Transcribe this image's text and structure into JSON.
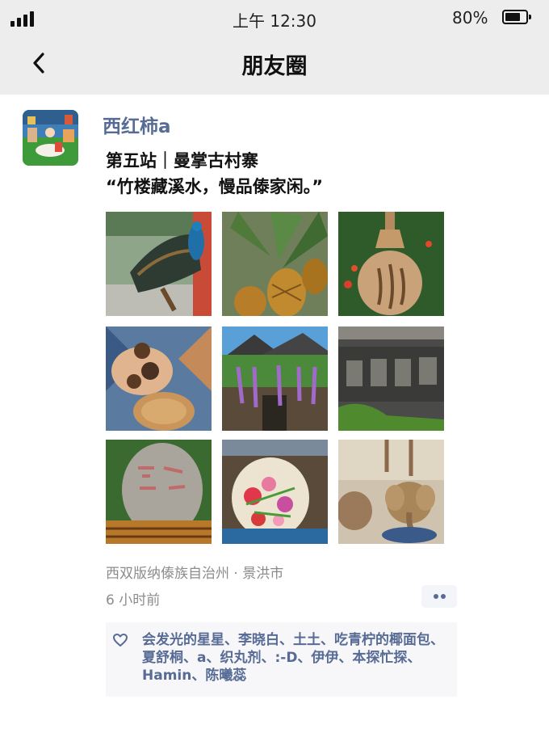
{
  "status_bar": {
    "time": "上午 12:30",
    "battery_percent": "80%",
    "battery_level": 0.8
  },
  "nav": {
    "title": "朋友圈",
    "back_icon": "chevron-left-icon"
  },
  "post": {
    "author": "西红柿a",
    "text_line1": "第五站｜曼掌古村寨",
    "text_line2": "“竹楼藏溪水，慢品傣家闲。”",
    "photos": [
      {
        "name": "peacock-photo"
      },
      {
        "name": "pineapple-photo"
      },
      {
        "name": "clay-lantern-photo"
      },
      {
        "name": "seed-pods-photo"
      },
      {
        "name": "wisteria-house-photo"
      },
      {
        "name": "wooden-sign-photo"
      },
      {
        "name": "carved-stone-photo"
      },
      {
        "name": "flower-fan-photo"
      },
      {
        "name": "clay-elephant-photo"
      }
    ],
    "location": "西双版纳傣族自治州 · 景洪市",
    "time_ago": "6 小时前",
    "likes_icon": "heart-icon",
    "likes": "会发光的星星、李晓白、土土、吃青柠的椰面包、夏舒桐、a、织丸剂、:-D、伊伊、本探忙探、Hamin、陈曦蕊"
  },
  "colors": {
    "link_blue": "#576b95",
    "header_bg": "#ededed",
    "meta_gray": "#8c8c8c"
  }
}
